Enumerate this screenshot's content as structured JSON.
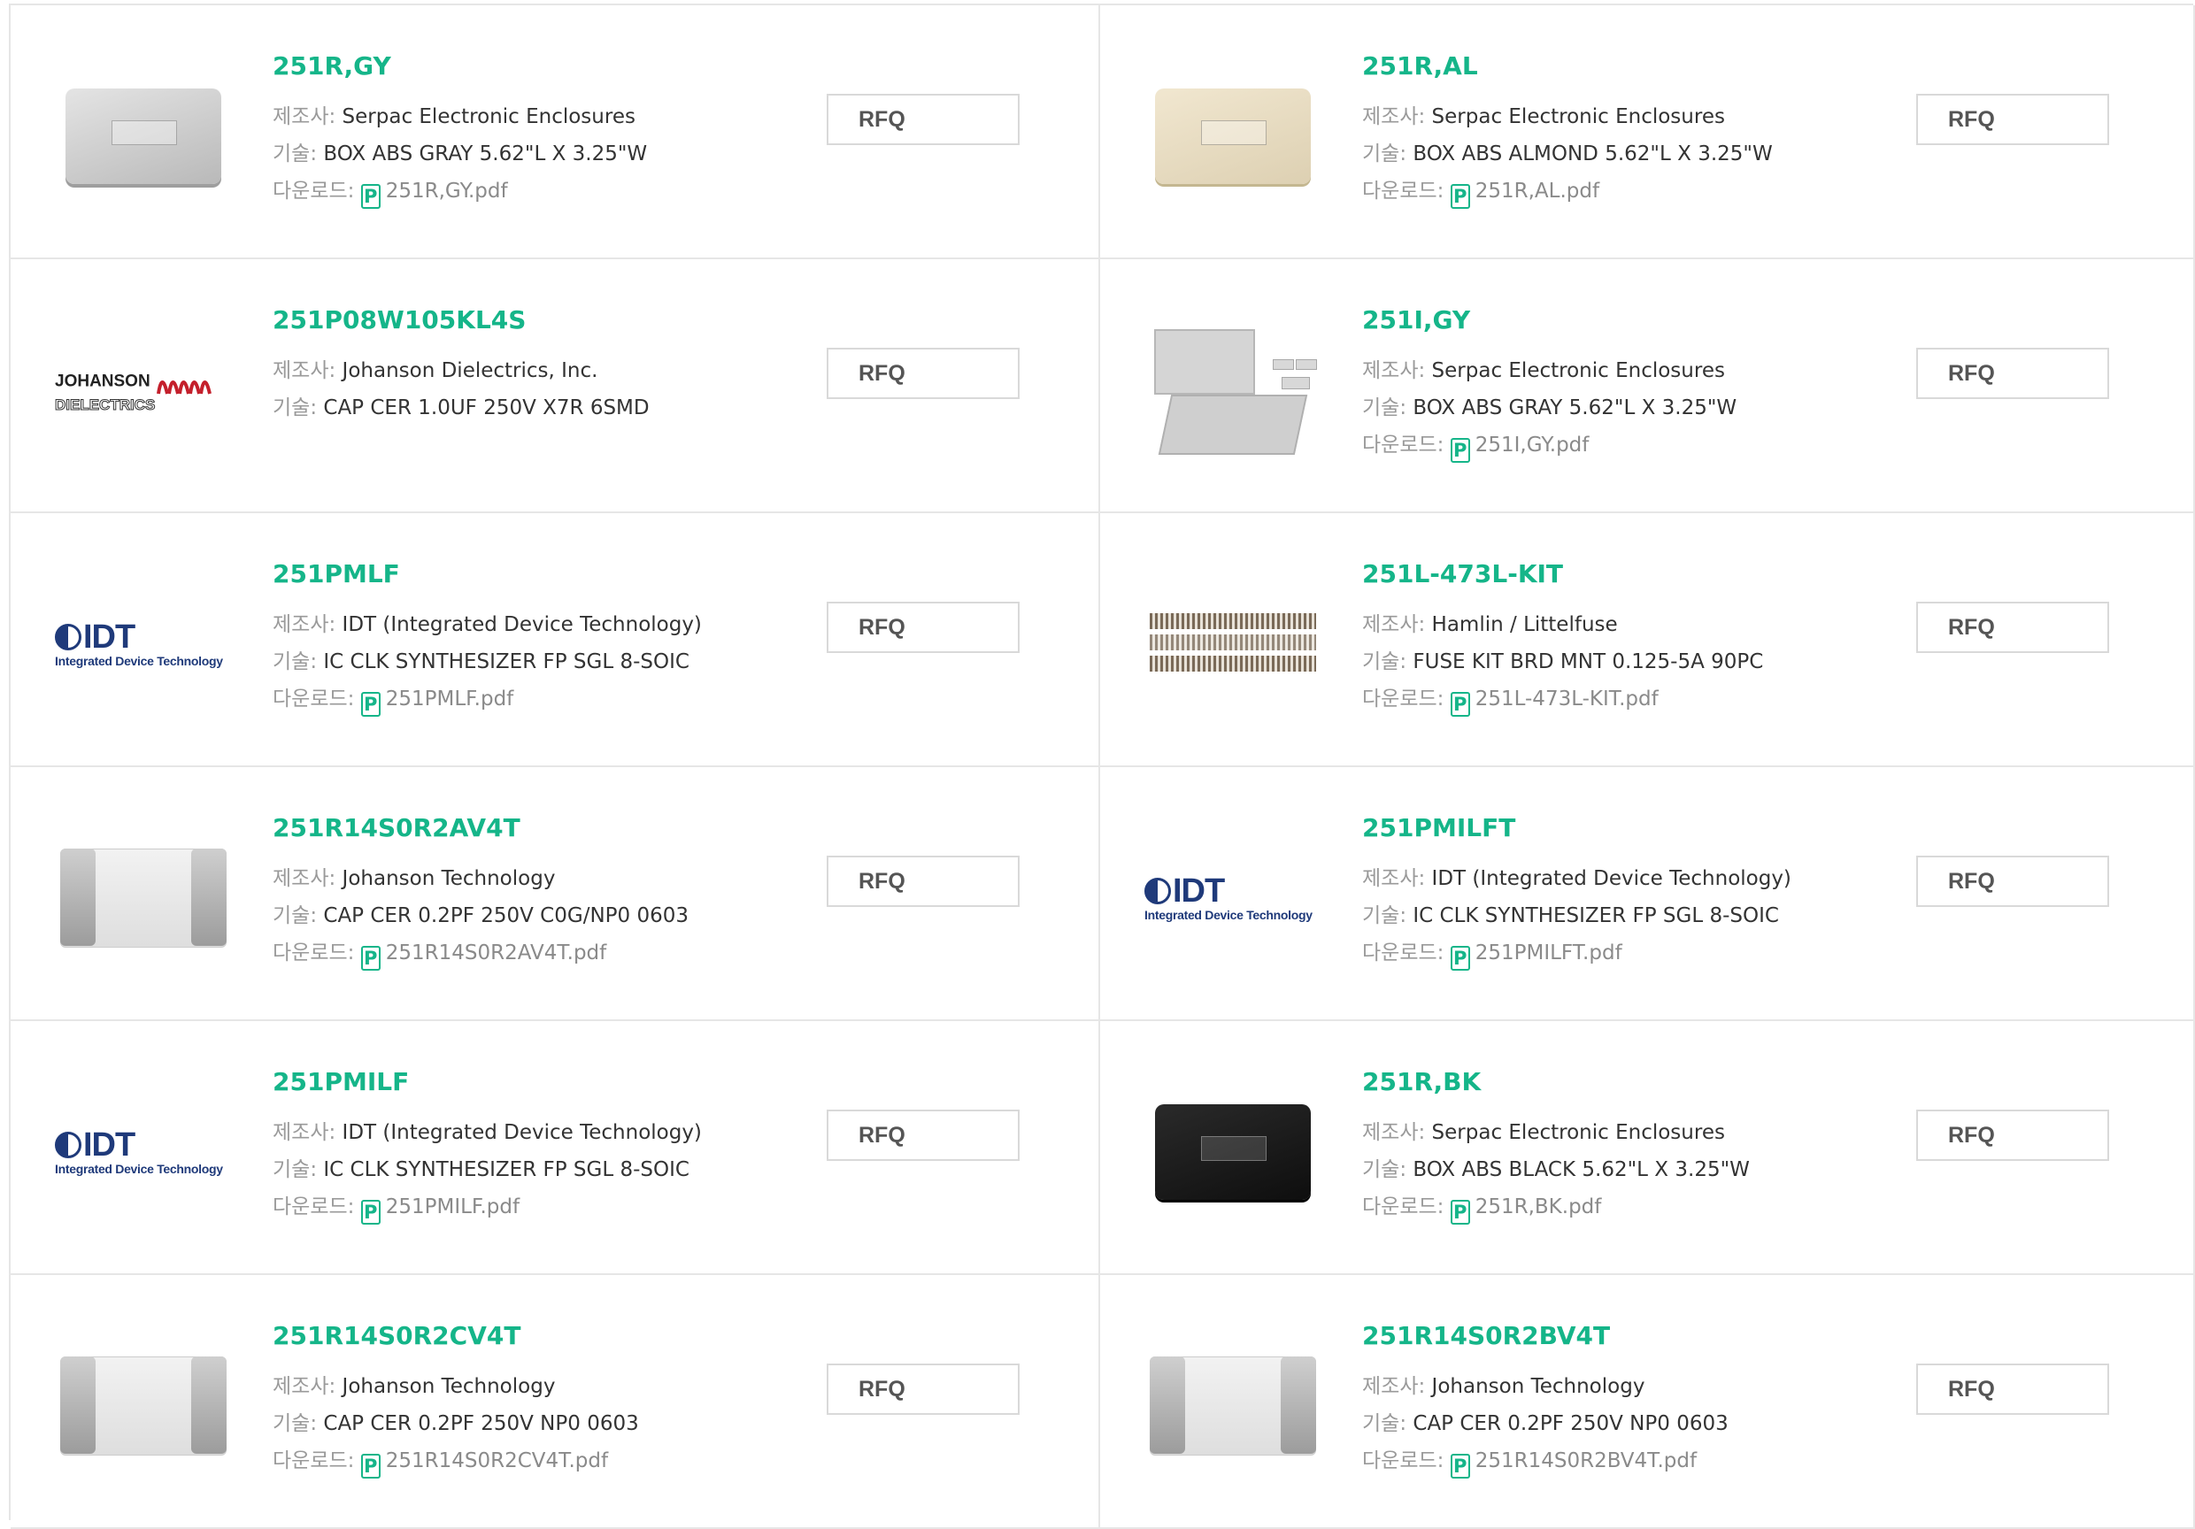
{
  "labels": {
    "manufacturer": "제조사:",
    "description": "기술:",
    "download": "다운로드:",
    "rfq": "RFQ",
    "pdf_icon": "P"
  },
  "accent_color": "#15b589",
  "products": [
    {
      "name": "251R,GY",
      "manufacturer": "Serpac Electronic Enclosures",
      "description": "BOX ABS GRAY 5.62\"L X 3.25\"W",
      "pdf": "251R,GY.pdf",
      "image": "enclosure-gray"
    },
    {
      "name": "251R,AL",
      "manufacturer": "Serpac Electronic Enclosures",
      "description": "BOX ABS ALMOND 5.62\"L X 3.25\"W",
      "pdf": "251R,AL.pdf",
      "image": "enclosure-almond"
    },
    {
      "name": "251P08W105KL4S",
      "manufacturer": "Johanson Dielectrics, Inc.",
      "description": "CAP CER 1.0UF 250V X7R 6SMD",
      "pdf": null,
      "image": "johanson-dielectrics-logo",
      "logo_text": [
        "JOHANSON",
        "DIELECTRICS"
      ]
    },
    {
      "name": "251I,GY",
      "manufacturer": "Serpac Electronic Enclosures",
      "description": "BOX ABS GRAY 5.62\"L X 3.25\"W",
      "pdf": "251I,GY.pdf",
      "image": "enclosure-open-gray"
    },
    {
      "name": "251PMLF",
      "manufacturer": "IDT (Integrated Device Technology)",
      "description": "IC CLK SYNTHESIZER FP SGL 8-SOIC",
      "pdf": "251PMLF.pdf",
      "image": "idt-logo",
      "logo_text": [
        "IDT",
        "Integrated Device Technology"
      ]
    },
    {
      "name": "251L-473L-KIT",
      "manufacturer": "Hamlin / Littelfuse",
      "description": "FUSE KIT BRD MNT 0.125-5A 90PC",
      "pdf": "251L-473L-KIT.pdf",
      "image": "fuse-kit"
    },
    {
      "name": "251R14S0R2AV4T",
      "manufacturer": "Johanson Technology",
      "description": "CAP CER 0.2PF 250V C0G/NP0 0603",
      "pdf": "251R14S0R2AV4T.pdf",
      "image": "chip-capacitor"
    },
    {
      "name": "251PMILFT",
      "manufacturer": "IDT (Integrated Device Technology)",
      "description": "IC CLK SYNTHESIZER FP SGL 8-SOIC",
      "pdf": "251PMILFT.pdf",
      "image": "idt-logo",
      "logo_text": [
        "IDT",
        "Integrated Device Technology"
      ]
    },
    {
      "name": "251PMILF",
      "manufacturer": "IDT (Integrated Device Technology)",
      "description": "IC CLK SYNTHESIZER FP SGL 8-SOIC",
      "pdf": "251PMILF.pdf",
      "image": "idt-logo",
      "logo_text": [
        "IDT",
        "Integrated Device Technology"
      ]
    },
    {
      "name": "251R,BK",
      "manufacturer": "Serpac Electronic Enclosures",
      "description": "BOX ABS BLACK 5.62\"L X 3.25\"W",
      "pdf": "251R,BK.pdf",
      "image": "enclosure-black"
    },
    {
      "name": "251R14S0R2CV4T",
      "manufacturer": "Johanson Technology",
      "description": "CAP CER 0.2PF 250V NP0 0603",
      "pdf": "251R14S0R2CV4T.pdf",
      "image": "chip-capacitor"
    },
    {
      "name": "251R14S0R2BV4T",
      "manufacturer": "Johanson Technology",
      "description": "CAP CER 0.2PF 250V NP0 0603",
      "pdf": "251R14S0R2BV4T.pdf",
      "image": "chip-capacitor"
    }
  ]
}
